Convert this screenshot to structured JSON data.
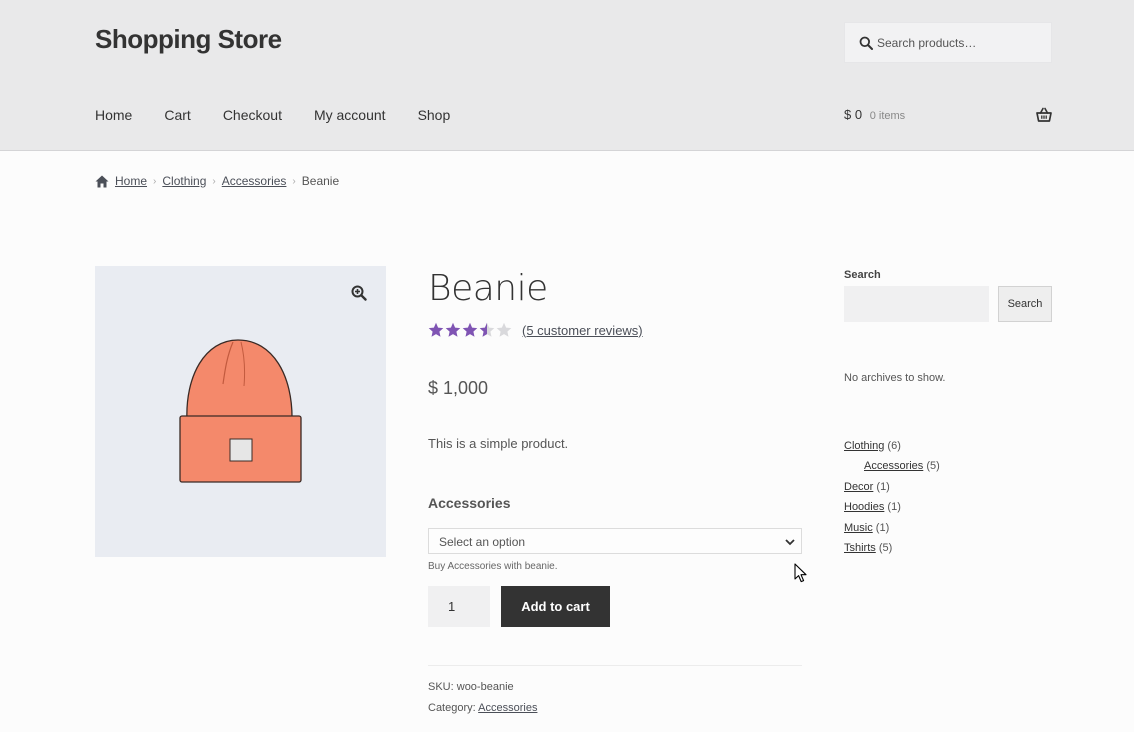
{
  "header": {
    "site_title": "Shopping Store",
    "search_placeholder": "Search products…",
    "nav": [
      "Home",
      "Cart",
      "Checkout",
      "My account",
      "Shop"
    ],
    "cart_amount": "$ 0",
    "cart_count": "0 items"
  },
  "breadcrumb": [
    "Home",
    "Clothing",
    "Accessories",
    "Beanie"
  ],
  "product": {
    "title": "Beanie",
    "rating": 3.5,
    "reviews_link": "(5 customer reviews)",
    "price": "$ 1,000",
    "short_description": "This is a simple product.",
    "variation_label": "Accessories",
    "variation_select": "Select an option",
    "variation_description": "Buy Accessories with beanie.",
    "quantity": "1",
    "add_to_cart": "Add to cart",
    "sku_label": "SKU:",
    "sku": "woo-beanie",
    "category_label": "Category:",
    "category": "Accessories"
  },
  "sidebar": {
    "search_title": "Search",
    "search_button": "Search",
    "no_archives": "No archives to show.",
    "categories": [
      {
        "name": "Clothing",
        "count": "(6)",
        "child": false
      },
      {
        "name": "Accessories",
        "count": "(5)",
        "child": true
      },
      {
        "name": "Decor",
        "count": "(1)",
        "child": false
      },
      {
        "name": "Hoodies",
        "count": "(1)",
        "child": false
      },
      {
        "name": "Music",
        "count": "(1)",
        "child": false
      },
      {
        "name": "Tshirts",
        "count": "(5)",
        "child": false
      }
    ]
  },
  "colors": {
    "header_bg": "#e9e9ea",
    "star": "#7f54b3",
    "button_dark": "#333333",
    "beanie": "#f4896b"
  },
  "icons": [
    "search-icon",
    "basket-icon",
    "home-icon",
    "zoom-icon",
    "star-icon",
    "chevron-down-icon",
    "cursor-icon"
  ]
}
